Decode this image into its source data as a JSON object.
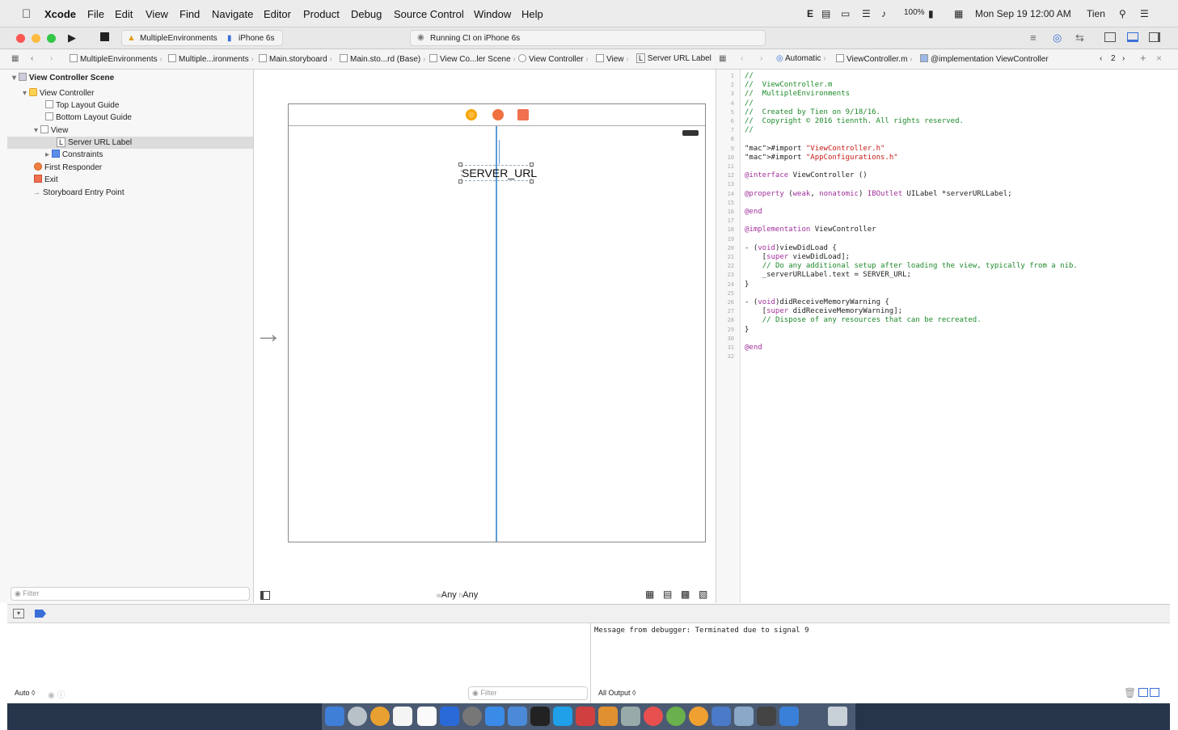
{
  "menubar": {
    "app_name": "Xcode",
    "items": [
      "File",
      "Edit",
      "View",
      "Find",
      "Navigate",
      "Editor",
      "Product",
      "Debug",
      "Source Control",
      "Window",
      "Help"
    ],
    "status": {
      "e": "E",
      "battery": "100%",
      "datetime": "Mon Sep 19  12:00 AM",
      "user": "Tien"
    }
  },
  "toolbar": {
    "scheme": "MultipleEnvironments",
    "device": "iPhone 6s",
    "activity": "Running CI on iPhone 6s"
  },
  "jumpbar_left": [
    "MultipleEnvironments",
    "Multiple...ironments",
    "Main.storyboard",
    "Main.sto...rd (Base)",
    "View Co...ler Scene",
    "View Controller",
    "View",
    "L",
    "Server URL Label"
  ],
  "jumpbar_right": {
    "mode": "Automatic",
    "file": "ViewController.m",
    "symbol": "@implementation ViewController",
    "counter": "2"
  },
  "outline": {
    "scene": "View Controller Scene",
    "items": [
      {
        "label": "View Controller"
      },
      {
        "label": "Top Layout Guide"
      },
      {
        "label": "Bottom Layout Guide"
      },
      {
        "label": "View"
      },
      {
        "label": "Server URL Label",
        "badge": "L"
      },
      {
        "label": "Constraints"
      },
      {
        "label": "First Responder"
      },
      {
        "label": "Exit"
      },
      {
        "label": "Storyboard Entry Point"
      }
    ],
    "filter_placeholder": "Filter"
  },
  "canvas": {
    "label_text": "SERVER_URL",
    "size_class": "wAny hAny",
    "size_w": "w",
    "size_any1": "Any",
    "size_h": "h",
    "size_any2": "Any"
  },
  "code": {
    "lines": [
      "//",
      "//  ViewController.m",
      "//  MultipleEnvironments",
      "//",
      "//  Created by Tien on 9/18/16.",
      "//  Copyright © 2016 tiennth. All rights reserved.",
      "//",
      "",
      "#import \"ViewController.h\"",
      "#import \"AppConfigurations.h\"",
      "",
      "@interface ViewController ()",
      "",
      "@property (weak, nonatomic) IBOutlet UILabel *serverURLLabel;",
      "",
      "@end",
      "",
      "@implementation ViewController",
      "",
      "- (void)viewDidLoad {",
      "    [super viewDidLoad];",
      "    // Do any additional setup after loading the view, typically from a nib.",
      "    _serverURLLabel.text = SERVER_URL;",
      "}",
      "",
      "- (void)didReceiveMemoryWarning {",
      "    [super didReceiveMemoryWarning];",
      "    // Dispose of any resources that can be recreated.",
      "}",
      "",
      "@end",
      ""
    ]
  },
  "debug": {
    "message": "Message from debugger: Terminated due to signal 9",
    "auto_label": "Auto ◊",
    "filter_placeholder": "Filter",
    "output_label": "All Output ◊"
  },
  "colors": {
    "selection": "#dcdcdc",
    "comment": "#1d8a2a",
    "keyword": "#a0309a",
    "string": "#c41a16",
    "dock": "#26354a"
  }
}
